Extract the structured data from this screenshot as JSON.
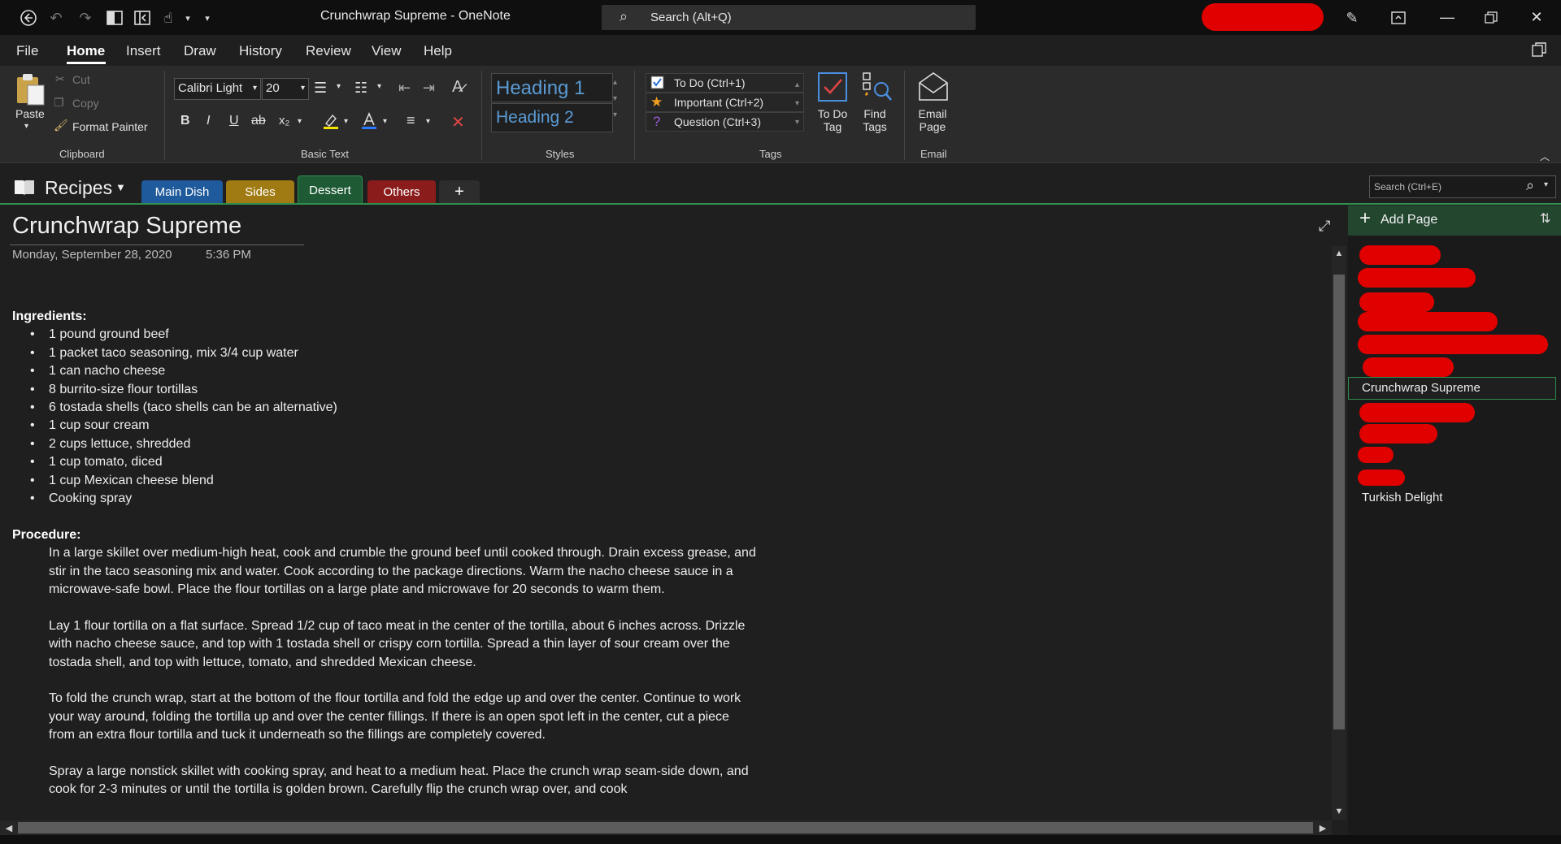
{
  "app": {
    "title": "Crunchwrap Supreme  -  OneNote",
    "search_placeholder": "Search (Alt+Q)"
  },
  "menu": [
    "File",
    "Home",
    "Insert",
    "Draw",
    "History",
    "Review",
    "View",
    "Help"
  ],
  "ribbon": {
    "clipboard": {
      "paste": "Paste",
      "cut": "Cut",
      "copy": "Copy",
      "format_painter": "Format Painter",
      "label": "Clipboard"
    },
    "basic_text": {
      "font": "Calibri Light",
      "size": "20",
      "label": "Basic Text"
    },
    "styles": {
      "heading1": "Heading 1",
      "heading2": "Heading 2",
      "label": "Styles"
    },
    "tags": {
      "todo": "To Do (Ctrl+1)",
      "important": "Important (Ctrl+2)",
      "question": "Question (Ctrl+3)",
      "todo_tag_1": "To Do",
      "todo_tag_2": "Tag",
      "find_tags_1": "Find",
      "find_tags_2": "Tags",
      "label": "Tags"
    },
    "email": {
      "email_page_1": "Email",
      "email_page_2": "Page",
      "label": "Email"
    }
  },
  "notebook": {
    "name": "Recipes",
    "tabs": [
      {
        "label": "Main Dish",
        "color": "#1f5a9c"
      },
      {
        "label": "Sides",
        "color": "#a07a12"
      },
      {
        "label": "Dessert",
        "color": "#1e5a34"
      },
      {
        "label": "Others",
        "color": "#8a1c1c"
      }
    ],
    "add_tab": "+",
    "search_placeholder": "Search (Ctrl+E)"
  },
  "page": {
    "title": "Crunchwrap Supreme",
    "date": "Monday, September 28, 2020",
    "time": "5:36 PM",
    "ingredients_heading": "Ingredients:",
    "ingredients": [
      "1 pound ground beef",
      "1 packet taco seasoning, mix 3/4 cup water",
      "1 can nacho cheese",
      "8 burrito-size flour tortillas",
      "6 tostada shells (taco shells can be an alternative)",
      "1 cup sour cream",
      "2 cups lettuce, shredded",
      "1 cup tomato, diced",
      "1 cup Mexican cheese blend",
      "Cooking spray"
    ],
    "procedure_heading": "Procedure:",
    "procedure": [
      "In a large skillet over medium-high heat, cook and crumble the ground beef until cooked through. Drain excess grease, and stir in the taco seasoning mix and water. Cook according to the package directions. Warm the nacho cheese sauce in a microwave-safe bowl. Place the flour tortillas on a large plate and microwave for 20 seconds to warm them.",
      "Lay 1 flour tortilla on a flat surface. Spread 1/2 cup of taco meat in the center of the tortilla, about 6 inches across. Drizzle with nacho cheese sauce, and top with 1 tostada shell or crispy corn tortilla. Spread a thin layer of sour cream over the tostada shell, and top with lettuce, tomato, and shredded Mexican cheese.",
      "To fold the crunch wrap, start at the bottom of the flour tortilla and fold the edge up and over the center. Continue to work your way around, folding the tortilla up and over the center fillings. If there is an open spot left in the center, cut a piece from an extra flour tortilla and tuck it underneath so the fillings are completely covered.",
      "Spray a large nonstick skillet with cooking spray, and heat to a medium heat. Place the crunch wrap seam-side down, and cook for 2-3 minutes or until the tortilla is golden brown. Carefully flip the crunch wrap over, and cook"
    ]
  },
  "pages_pane": {
    "add_page": "Add Page",
    "pages": [
      "Crunchwrap Supreme",
      "Turkish Delight"
    ]
  }
}
